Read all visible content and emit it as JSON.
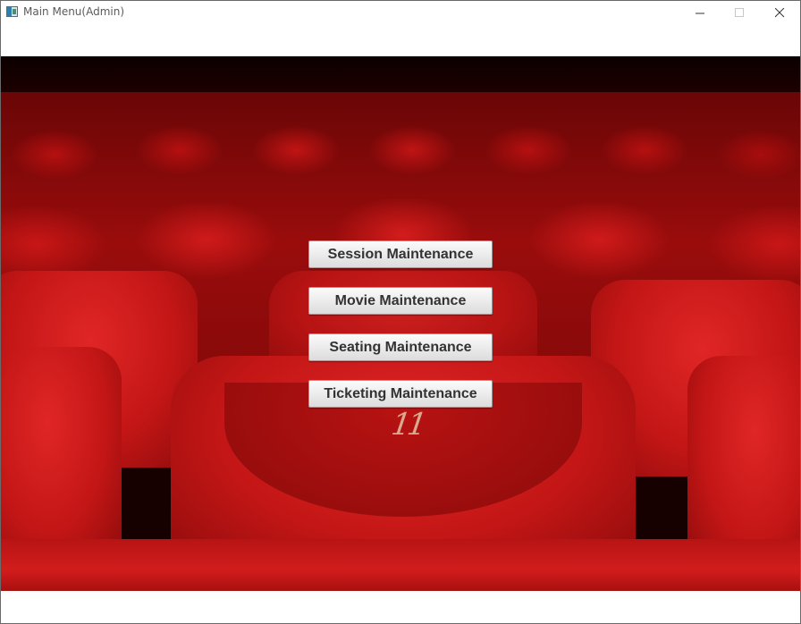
{
  "window": {
    "title": "Main Menu(Admin)",
    "icon": "java-app-icon",
    "controls": [
      "minimize-icon",
      "maximize-icon",
      "close-icon"
    ]
  },
  "background": {
    "image": "red-cinema-seats",
    "seat_number": "11"
  },
  "menu": {
    "buttons": [
      {
        "label": "Session Maintenance"
      },
      {
        "label": "Movie Maintenance"
      },
      {
        "label": "Seating Maintenance"
      },
      {
        "label": "Ticketing Maintenance"
      }
    ]
  },
  "colors": {
    "accent": "#d21c1c",
    "button_text": "#333333"
  }
}
